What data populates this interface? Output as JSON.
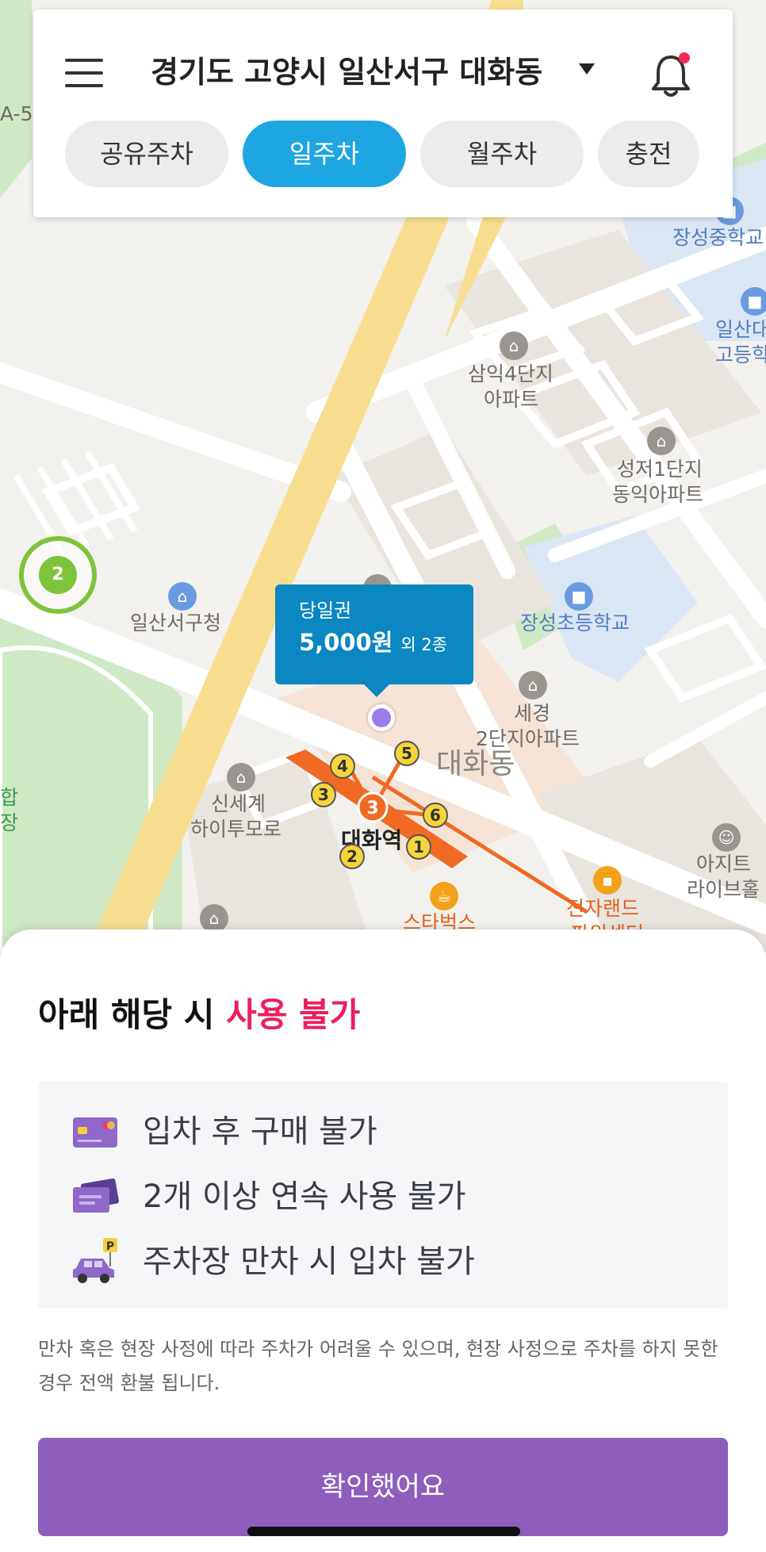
{
  "header": {
    "location": "경기도 고양시 일산서구 대화동",
    "tabs": [
      {
        "label": "공유주차",
        "active": false
      },
      {
        "label": "일주차",
        "active": true
      },
      {
        "label": "월주차",
        "active": false
      },
      {
        "label": "충전",
        "active": false
      }
    ],
    "has_notification": true
  },
  "map": {
    "labels": {
      "road_code": "A-5",
      "school_top": "장성중학교",
      "school_right_1": "일산대",
      "school_right_2": "고등학",
      "apt1_1": "삼익4단지",
      "apt1_2": "아파트",
      "apt2_1": "성저1단지",
      "apt2_2": "동익아파트",
      "gov_office": "일산서구청",
      "elementary": "장성초등학교",
      "apt3_1": "세경",
      "apt3_2": "2단지아파트",
      "district": "대화동",
      "mall_1": "신세계",
      "mall_2": "하이투모로",
      "station": "대화역",
      "edge_left_1": "합",
      "edge_left_2": "장",
      "electronics_1": "전자랜드",
      "electronics_2": "파워센터",
      "live_1": "아지트",
      "live_2": "라이브홀",
      "cafe": "스타벅스"
    },
    "station_exits": [
      "1",
      "2",
      "3",
      "4",
      "5",
      "6"
    ],
    "cluster_count": "2",
    "price_bubble": {
      "kind": "당일권",
      "price": "5,000원",
      "extra": "외 2종"
    }
  },
  "sheet": {
    "title_prefix": "아래 해당 시",
    "title_warn": "사용 불가",
    "rules": [
      {
        "icon": "credit-card-icon",
        "text": "입차 후 구매 불가"
      },
      {
        "icon": "tickets-icon",
        "text": "2개 이상 연속 사용 불가"
      },
      {
        "icon": "car-parking-icon",
        "text": "주차장 만차 시 입차 불가"
      }
    ],
    "note": "만차 혹은 현장 사정에 따라 주차가 어려울 수 있으며, 현장 사정으로 주차를 하지 못한 경우 전액 환불 됩니다.",
    "confirm_label": "확인했어요"
  },
  "colors": {
    "accent_blue": "#1da6e2",
    "bubble_blue": "#0b87c2",
    "warn_pink": "#ec1f5c",
    "confirm_purple": "#8d5ebb",
    "cluster_green": "#7ec43a",
    "subway_orange": "#f06a24"
  }
}
